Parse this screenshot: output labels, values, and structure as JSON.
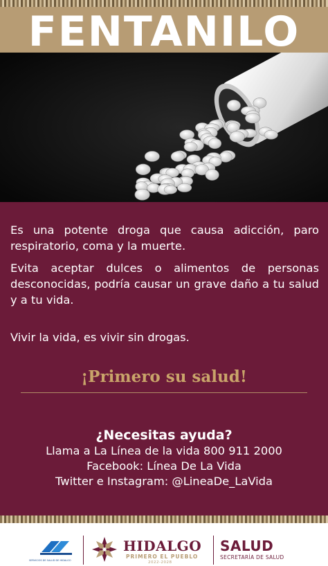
{
  "header": {
    "title": "FENTANILO"
  },
  "image": {
    "subject": "pills-spilling-from-bottle"
  },
  "body": {
    "paragraph1": "Es una potente droga que causa adicción, paro respiratorio, coma y la muerte.",
    "paragraph2": "Evita aceptar dulces o alimentos de personas desconocidas, podría causar un grave daño a tu salud y a tu vida.",
    "paragraph3": "Vivir la vida, es vivir sin drogas."
  },
  "slogan": "¡Primero su salud!",
  "help": {
    "title": "¿Necesitas ayuda?",
    "line1": "Llama a La Línea de la vida 800 911 2000",
    "line2": "Facebook: Línea De La Vida",
    "line3": "Twitter e Instagram: @LineaDe_LaVida"
  },
  "footer": {
    "left_logo_caption": "SERVICIOS DE SALUD DE HIDALGO",
    "hidalgo": "HIDALGO",
    "hidalgo_sub": "PRIMERO EL PUEBLO",
    "hidalgo_years": "2022-2028",
    "salud": "SALUD",
    "salud_sub": "SECRETARÍA DE SALUD"
  },
  "colors": {
    "burgundy": "#6b1b39",
    "gold": "#b79c74",
    "slogan": "#c9a46a"
  }
}
